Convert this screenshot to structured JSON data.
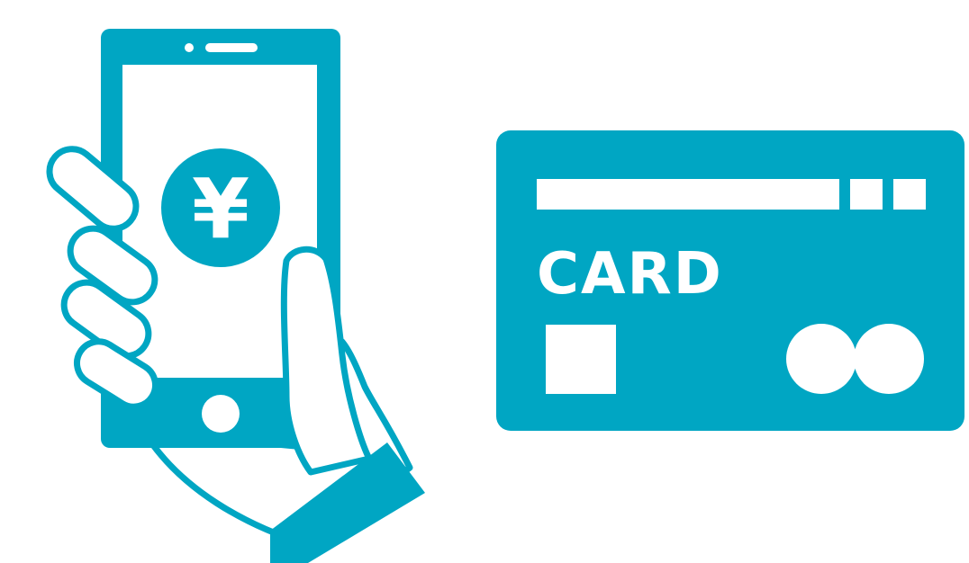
{
  "colors": {
    "accent": "#00A6C3",
    "background": "#FFFFFF"
  },
  "smartphone": {
    "screen_symbol": "¥",
    "icons": [
      "smartphone-icon",
      "hand-icon",
      "yen-coin-icon",
      "home-button-icon"
    ]
  },
  "credit_card": {
    "label": "CARD",
    "icons": [
      "credit-card-icon",
      "magnetic-stripe-icon",
      "chip-icon",
      "card-brand-logo-icon"
    ]
  }
}
